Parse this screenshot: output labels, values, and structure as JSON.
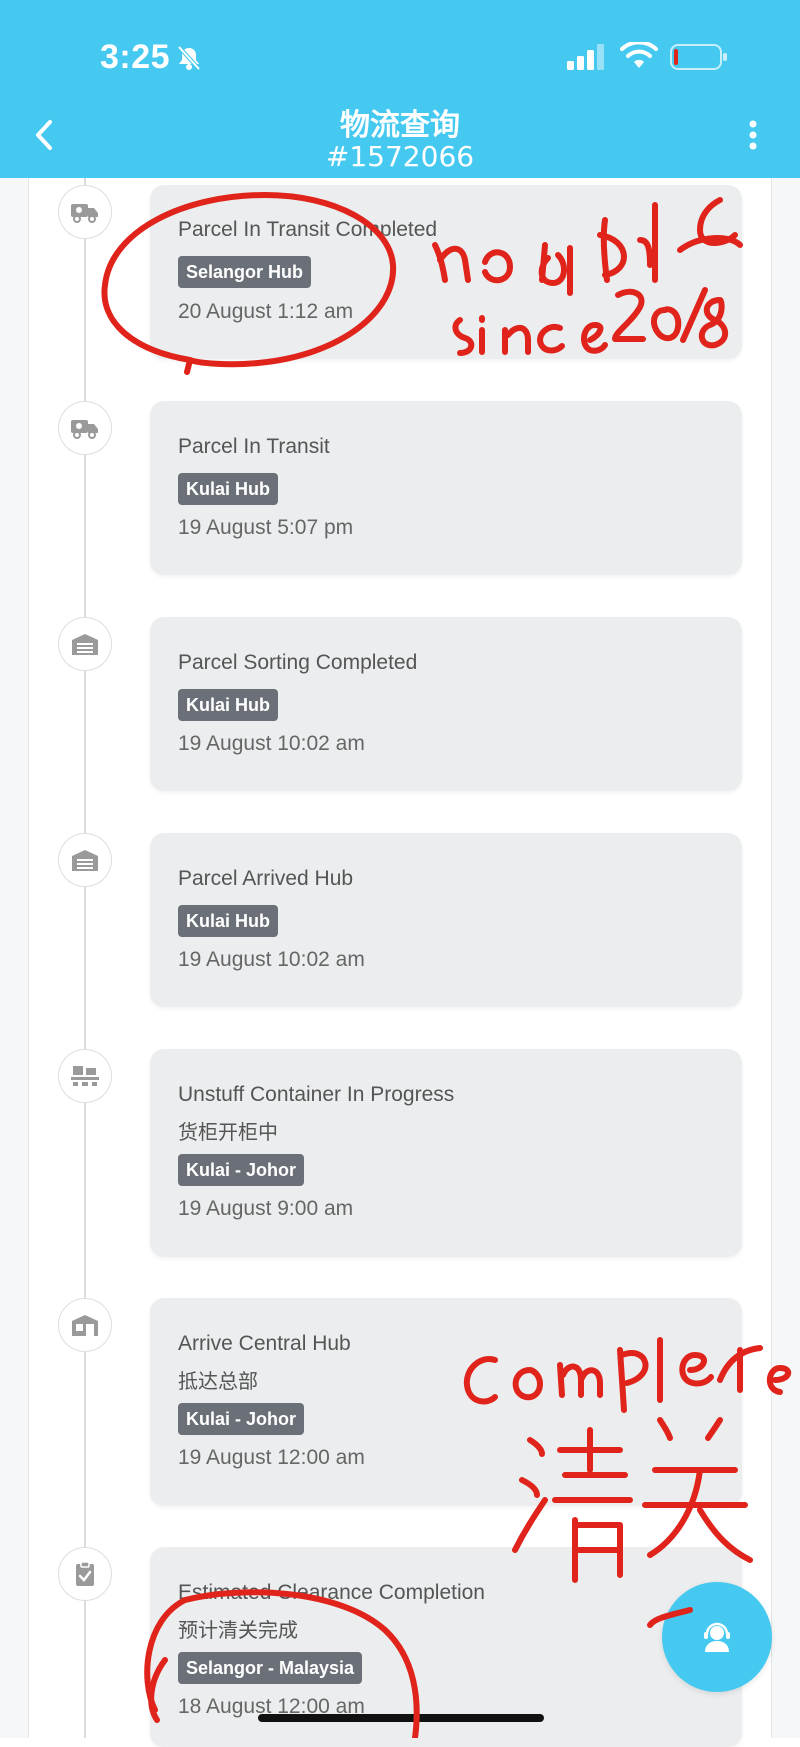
{
  "status_bar": {
    "time": "3:25"
  },
  "header": {
    "title": "物流查询",
    "order": "#1572066"
  },
  "events": [
    {
      "title": "Parcel In Transit Completed",
      "badge": "Selangor Hub",
      "date": "20 August 1:12 am"
    },
    {
      "title": "Parcel In Transit",
      "badge": "Kulai Hub",
      "date": "19 August 5:07 pm"
    },
    {
      "title": "Parcel Sorting Completed",
      "badge": "Kulai Hub",
      "date": "19 August 10:02 am"
    },
    {
      "title": "Parcel Arrived Hub",
      "badge": "Kulai Hub",
      "date": "19 August 10:02 am"
    },
    {
      "title": "Unstuff Container In Progress",
      "subtitle": "货柜开柜中",
      "badge": "Kulai - Johor",
      "date": "19 August 9:00 am"
    },
    {
      "title": "Arrive Central Hub",
      "subtitle": "抵达总部",
      "badge": "Kulai - Johor",
      "date": "19 August 12:00 am"
    },
    {
      "title": "Estimated Clearance Completion",
      "subtitle": "预计清关完成",
      "badge": "Selangor - Malaysia",
      "date": "18 August 12:00 am"
    }
  ],
  "colors": {
    "header": "#45c9f0",
    "card": "#ebedee",
    "badge": "#6b7078",
    "annotation": "#e0241b"
  }
}
